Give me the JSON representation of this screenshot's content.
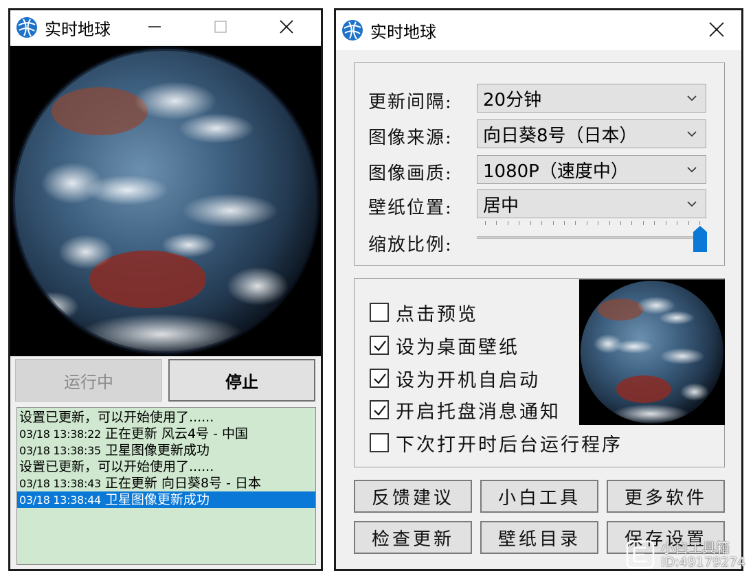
{
  "left_window": {
    "title": "实时地球",
    "icon": "globe-app-icon",
    "controls": [
      "minimize-icon",
      "maximize-icon",
      "close-icon"
    ],
    "buttons": {
      "running": "运行中",
      "stop": "停止"
    },
    "log": [
      {
        "ts": "",
        "text": "设置已更新，可以开始使用了......",
        "selected": false
      },
      {
        "ts": "03/18 13:38:22",
        "text": " 正在更新 风云4号 - 中国",
        "selected": false
      },
      {
        "ts": "03/18 13:38:35",
        "text": " 卫星图像更新成功",
        "selected": false
      },
      {
        "ts": "",
        "text": "设置已更新，可以开始使用了......",
        "selected": false
      },
      {
        "ts": "03/18 13:38:43",
        "text": " 正在更新 向日葵8号 - 日本",
        "selected": false
      },
      {
        "ts": "03/18 13:38:44",
        "text": " 卫星图像更新成功",
        "selected": true
      }
    ],
    "colors": {
      "log_bg": "#cfe8cf",
      "selection": "#0a78d7"
    }
  },
  "right_window": {
    "title": "实时地球",
    "settings": {
      "interval": {
        "label": "更新间隔:",
        "value": "20分钟"
      },
      "source": {
        "label": "图像来源:",
        "value": "向日葵8号（日本）"
      },
      "quality": {
        "label": "图像画质:",
        "value": "1080P（速度中）"
      },
      "position": {
        "label": "壁纸位置:",
        "value": "居中"
      },
      "scale": {
        "label": "缩放比例:",
        "value_fraction": 1.0
      }
    },
    "options": [
      {
        "label": "点击预览",
        "checked": false
      },
      {
        "label": "设为桌面壁纸",
        "checked": true
      },
      {
        "label": "设为开机自启动",
        "checked": true
      },
      {
        "label": "开启托盘消息通知",
        "checked": true
      },
      {
        "label": "下次打开时后台运行程序",
        "checked": false
      }
    ],
    "buttons": {
      "feedback": "反馈建议",
      "tools": "小白工具",
      "more": "更多软件",
      "update": "检查更新",
      "wallpaper_dir": "壁纸目录",
      "save": "保存设置"
    },
    "colors": {
      "slider_thumb": "#0a78d7"
    }
  },
  "watermark": {
    "line1": "小白工具箱",
    "line2": "ID:49179274"
  }
}
